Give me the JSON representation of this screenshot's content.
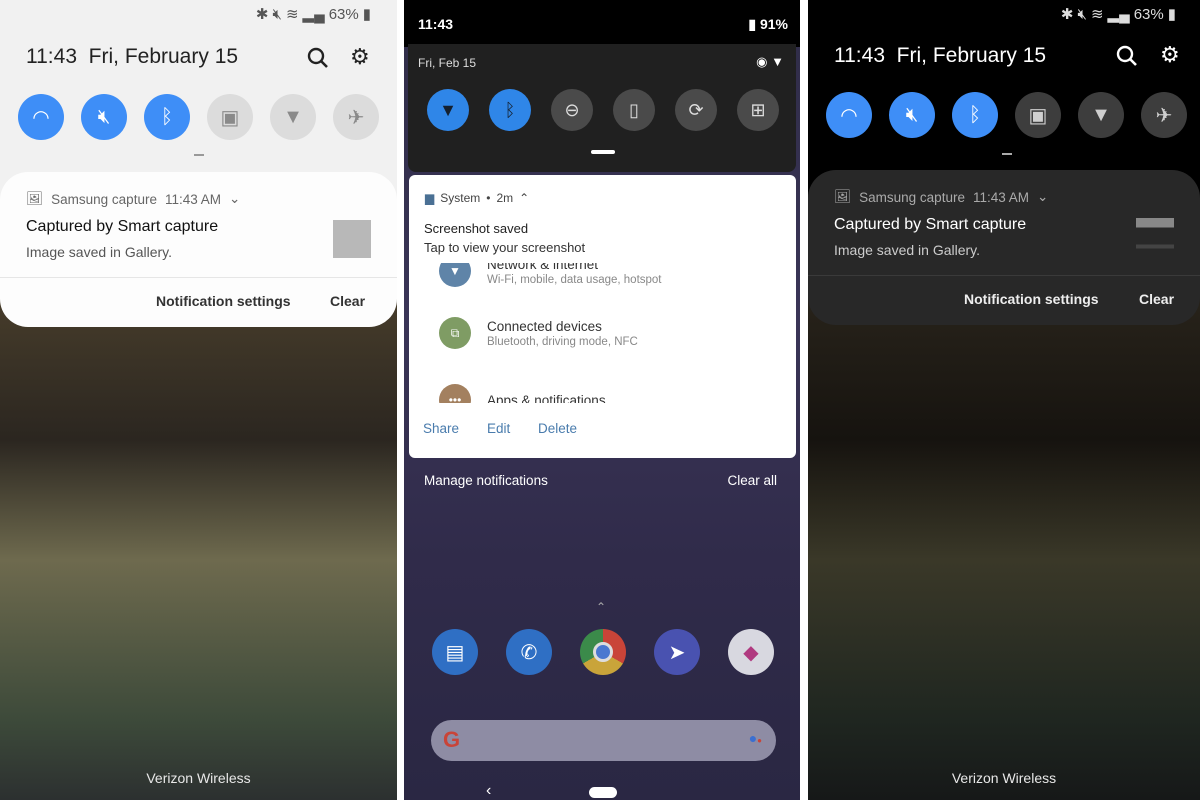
{
  "samsung_light": {
    "status": {
      "battery": "63%"
    },
    "time": "11:43",
    "date": "Fri, February 15",
    "toggles": [
      {
        "icon": "wifi-icon",
        "on": true
      },
      {
        "icon": "mute-vibrate-icon",
        "on": true
      },
      {
        "icon": "bluetooth-icon",
        "on": true
      },
      {
        "icon": "screen-lock-icon",
        "on": false
      },
      {
        "icon": "flashlight-icon",
        "on": false
      },
      {
        "icon": "airplane-icon",
        "on": false
      }
    ],
    "notification": {
      "app": "Samsung capture",
      "time": "11:43 AM",
      "title": "Captured by Smart capture",
      "text": "Image saved in Gallery.",
      "settings_label": "Notification settings",
      "clear_label": "Clear"
    },
    "carrier": "Verizon Wireless"
  },
  "pixel": {
    "status": {
      "time": "11:43",
      "battery": "91%"
    },
    "date": "Fri, Feb 15",
    "toggles": [
      {
        "icon": "wifi-icon",
        "on": true
      },
      {
        "icon": "bluetooth-icon",
        "on": true
      },
      {
        "icon": "do-not-disturb-icon",
        "on": false
      },
      {
        "icon": "flashlight-icon",
        "on": false
      },
      {
        "icon": "auto-rotate-icon",
        "on": false
      },
      {
        "icon": "battery-saver-icon",
        "on": false
      }
    ],
    "notification": {
      "app": "System",
      "age": "2m",
      "title": "Screenshot saved",
      "text": "Tap to view your screenshot",
      "preview": [
        {
          "title": "Network & internet",
          "subtitle": "Wi-Fi, mobile, data usage, hotspot",
          "color": "#5f84a8"
        },
        {
          "title": "Connected devices",
          "subtitle": "Bluetooth, driving mode, NFC",
          "color": "#7f9c64"
        },
        {
          "title": "Apps & notifications",
          "subtitle": "",
          "color": "#a3805f"
        }
      ],
      "actions": [
        "Share",
        "Edit",
        "Delete"
      ]
    },
    "manage_label": "Manage notifications",
    "clear_all_label": "Clear all",
    "dock": [
      "messages-icon",
      "phone-icon",
      "chrome-icon",
      "direct-mail-icon",
      "kinescope-icon"
    ]
  },
  "samsung_dark": {
    "status": {
      "battery": "63%"
    },
    "time": "11:43",
    "date": "Fri, February 15",
    "notification": {
      "app": "Samsung capture",
      "time": "11:43 AM",
      "title": "Captured by Smart capture",
      "text": "Image saved in Gallery.",
      "settings_label": "Notification settings",
      "clear_label": "Clear"
    },
    "carrier": "Verizon Wireless"
  },
  "colors": {
    "accent_blue": "#3e8ef7",
    "pixel_link": "#4a7cad"
  }
}
